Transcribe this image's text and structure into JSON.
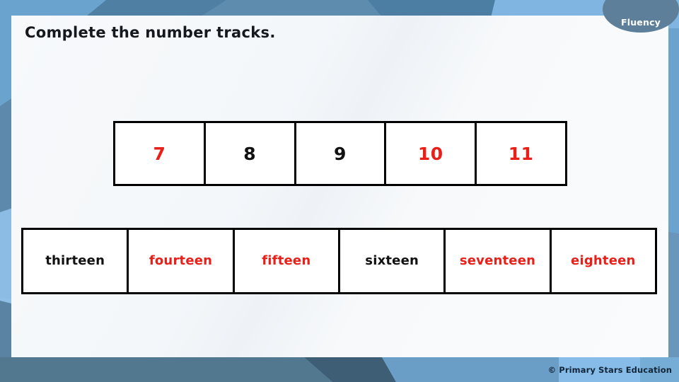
{
  "badge": {
    "label": "Fluency"
  },
  "title": "Complete the number tracks.",
  "colors": {
    "answer_red": "#e8201a",
    "given_black": "#111111",
    "badge_blue": "#5d7f9a",
    "band_blue": "#7fb0d8",
    "card_white": "#f7f9fb"
  },
  "tracks": [
    {
      "name": "numbers-track",
      "cells": [
        {
          "text": "7",
          "ink": "red"
        },
        {
          "text": "8",
          "ink": "black"
        },
        {
          "text": "9",
          "ink": "black"
        },
        {
          "text": "10",
          "ink": "red"
        },
        {
          "text": "11",
          "ink": "red"
        }
      ]
    },
    {
      "name": "words-track",
      "cells": [
        {
          "text": "thirteen",
          "ink": "black"
        },
        {
          "text": "fourteen",
          "ink": "red"
        },
        {
          "text": "fifteen",
          "ink": "red"
        },
        {
          "text": "sixteen",
          "ink": "black"
        },
        {
          "text": "seventeen",
          "ink": "red"
        },
        {
          "text": "eighteen",
          "ink": "red"
        }
      ]
    }
  ],
  "footer": {
    "copyright": "© Primary Stars Education"
  }
}
